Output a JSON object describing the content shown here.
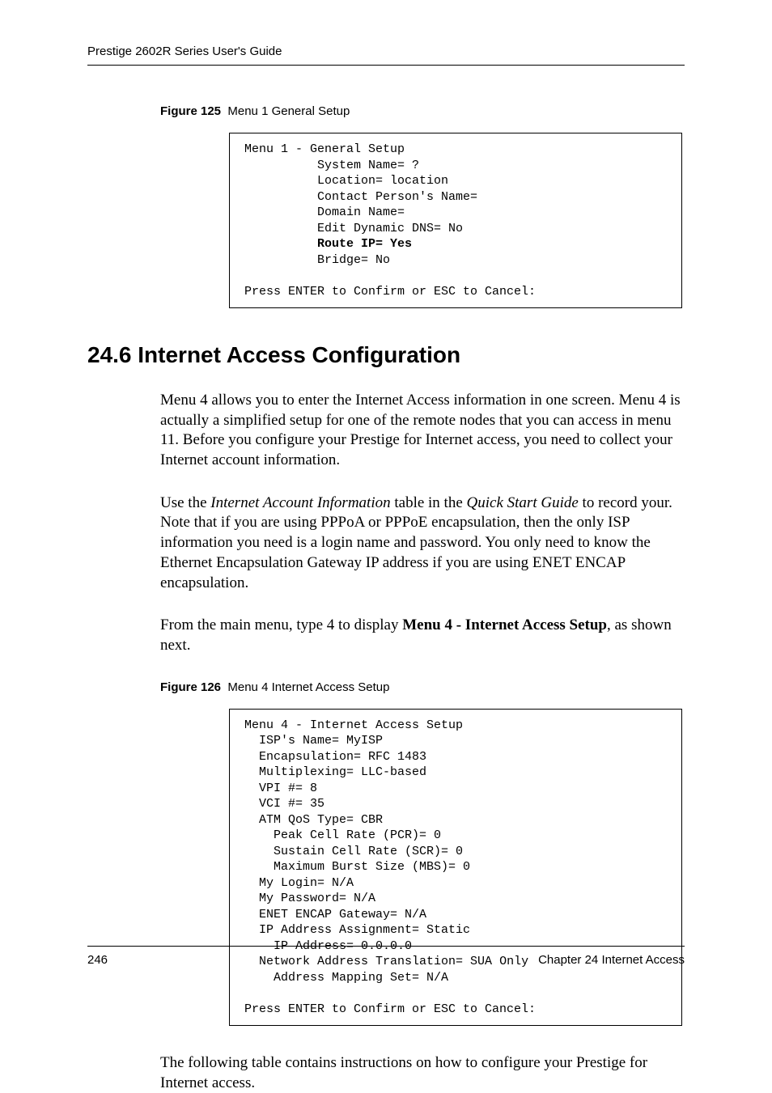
{
  "header": {
    "title": "Prestige 2602R Series User's Guide"
  },
  "figure125": {
    "num": "Figure 125",
    "title": "Menu 1 General Setup",
    "menu": {
      "title": "Menu 1 - General Setup",
      "lines": [
        "System Name= ?",
        "Location= location",
        "Contact Person's Name=",
        "Domain Name=",
        "Edit Dynamic DNS= No"
      ],
      "bold_line": "Route IP= Yes",
      "after_bold": "Bridge= No",
      "footer": "Press ENTER to Confirm or ESC to Cancel:"
    }
  },
  "section": {
    "heading": "24.6  Internet Access Configuration",
    "para1": "Menu 4 allows you to enter the Internet Access information in one screen.  Menu 4 is actually a simplified setup for one of the remote nodes that you can access in menu 11.  Before you configure your Prestige for Internet access, you need to collect your Internet account information.",
    "para2_a": "Use the ",
    "para2_i1": "Internet Account Information",
    "para2_b": " table in the ",
    "para2_i2": "Quick Start Guide",
    "para2_c": " to record your. Note that if you are using PPPoA or PPPoE encapsulation, then the only ISP information you need is a login name and password. You only need to know the Ethernet Encapsulation Gateway IP address if you are using ENET ENCAP encapsulation.",
    "para3_a": "From the main menu, type 4 to display ",
    "para3_b": "Menu 4 - Internet Access Setup",
    "para3_c": ", as shown next."
  },
  "figure126": {
    "num": "Figure 126",
    "title": "Menu 4 Internet Access Setup",
    "menu": {
      "title": "Menu 4 - Internet Access Setup",
      "l1": "ISP's Name= MyISP",
      "l2": "Encapsulation= RFC 1483",
      "l3": "Multiplexing= LLC-based",
      "l4": "VPI #= 8",
      "l5": "VCI #= 35",
      "l6": "ATM QoS Type= CBR",
      "l7": "Peak Cell Rate (PCR)= 0",
      "l8": "Sustain Cell Rate (SCR)= 0",
      "l9": "Maximum Burst Size (MBS)= 0",
      "l10": "My Login= N/A",
      "l11": "My Password= N/A",
      "l12": "ENET ENCAP Gateway= N/A",
      "l13": "IP Address Assignment= Static",
      "l14": "IP Address= 0.0.0.0",
      "l15": "Network Address Translation= SUA Only",
      "l16": "Address Mapping Set= N/A",
      "footer": "Press ENTER to Confirm or ESC to Cancel:"
    }
  },
  "closing_para": "The following table contains instructions on how to configure your Prestige for Internet access.",
  "footer": {
    "page": "246",
    "chapter": "Chapter 24 Internet Access"
  }
}
